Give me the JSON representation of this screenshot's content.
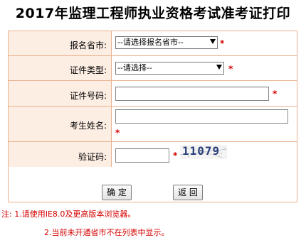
{
  "page": {
    "title": "2017年监理工程师执业资格考试准考证打印"
  },
  "form": {
    "province": {
      "label": "报名省市:",
      "selected": "--请选择报名省市--",
      "required_mark": "*"
    },
    "id_type": {
      "label": "证件类型:",
      "selected": "--请选择--",
      "required_mark": "*"
    },
    "id_number": {
      "label": "证件号码:",
      "value": "",
      "required_mark": "*"
    },
    "name": {
      "label": "考生姓名:",
      "value": "",
      "required_mark": "*"
    },
    "captcha": {
      "label": "验证码:",
      "value": "",
      "required_mark": "*",
      "image_text": "11079"
    }
  },
  "buttons": {
    "confirm": "确 定",
    "back": "返 回"
  },
  "notes": {
    "line1": "注: 1.请使用IE8.0及更高版本浏览器。",
    "line2": "2.当前未开通省市不在列表中显示。"
  },
  "colors": {
    "border": "#e9b08c",
    "label_bg": "#fdeee4",
    "required": "#d40000"
  },
  "icons": {
    "select_arrow": "chevron-down-icon"
  }
}
